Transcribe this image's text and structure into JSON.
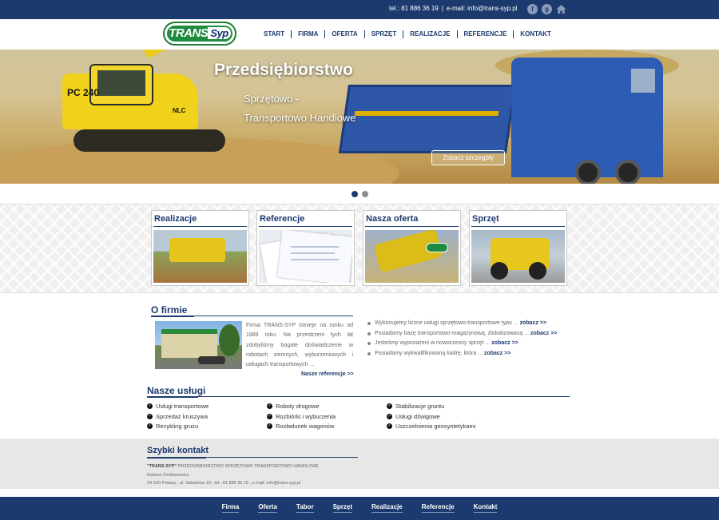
{
  "topbar": {
    "phone": "tel.: 81 886 36 19",
    "email": "e-mail: info@trans-syp.pl",
    "icons": [
      "facebook-icon",
      "google-plus-icon",
      "home-icon"
    ]
  },
  "logo": {
    "part1": "TRANS",
    "part2": "yp"
  },
  "nav": [
    "START",
    "FIRMA",
    "OFERTA",
    "SPRZĘT",
    "REALIZACJE",
    "REFERENCJE",
    "KONTAKT"
  ],
  "slider": {
    "title": "Przedsiębiorstwo",
    "line1": "Sprzętowo -",
    "line2": "Transportowo Handlowe",
    "button": "Zobacz szczegóły",
    "excavator_model": "PC 240",
    "excavator_sub": "NLC"
  },
  "cards": [
    {
      "title": "Realizacje"
    },
    {
      "title": "Referencje"
    },
    {
      "title": "Nasza oferta"
    },
    {
      "title": "Sprzęt"
    }
  ],
  "about": {
    "title": "O firmie",
    "text": "Firma TRANS-SYP istnieje na runku od 1989 roku. Na przestrzeni tych lat zdobyliśmy bogate doświadczenie w robotach ziemnych, wyburzeniowych i usługach transportowych ...",
    "more": "Nasze referencje >>"
  },
  "bullets": [
    {
      "text": "Wykonujemy liczne usługi sprzętowo-transportowe typu ... ",
      "link": "zobacz >>"
    },
    {
      "text": "Posiadamy bazę transportowo-magazynową, zlokalizowaną ... ",
      "link": "zobacz >>"
    },
    {
      "text": "Jesteśmy wyposażeni w nowoczesny sprzęt ... ",
      "link": "zobacz >>"
    },
    {
      "text": "Posiadamy wykwalifikowaną kadrę, która ... ",
      "link": "zobacz >>"
    }
  ],
  "services": {
    "title": "Nasze usługi",
    "col1": [
      "Usługi transportowe",
      "Sprzedaż kruszywa",
      "Recykling gruzu"
    ],
    "col2": [
      "Roboty drogowe",
      "Rozbiórki i wyburzenia",
      "Rozładunek wagonów"
    ],
    "col3": [
      "Stabilizacje gruntu",
      "Usługi dźwigowe",
      "Uszczelnienia geosyntetykami"
    ]
  },
  "quick_contact": {
    "title": "Szybki kontakt",
    "company_bold": "\"TRANS-SYP\"",
    "company_rest": " PRZEDSIĘBIORSTWO SPRZĘTOWO TRANSPORTOWO HANDLOWE",
    "person": "Dariusz Omilianowicz",
    "address": "24-100 Puławy , ul. Składowa 10 , tel.: 81 886 36 19 , e-mail: info@trans-syp.pl"
  },
  "footer_nav": [
    "Firma",
    "Oferta",
    "Tabor",
    "Sprzęt",
    "Realizacje",
    "Referencje",
    "Kontakt"
  ],
  "colors": {
    "primary": "#1c3a6e",
    "logo_green": "#1e8c3e",
    "band_bg": "#efefef",
    "contact_bg": "#e7e7e7"
  }
}
